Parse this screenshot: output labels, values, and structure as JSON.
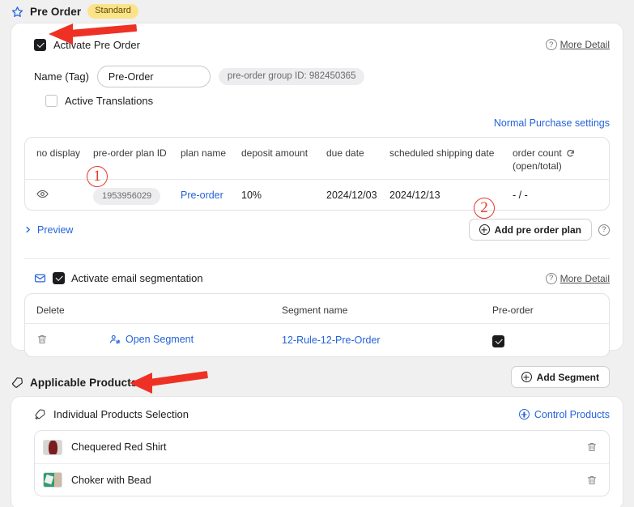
{
  "page": {
    "background": "#f0f0f0",
    "accent_blue": "#2563d9",
    "annotation_red": "#e8392a",
    "badge_yellow": "#fbe38a"
  },
  "pre_order_section": {
    "icon": "star-icon",
    "title": "Pre Order",
    "badge": "Standard",
    "activate": {
      "label": "Activate Pre Order",
      "checked": true
    },
    "more_detail": "More Detail",
    "name_tag": {
      "label": "Name (Tag)",
      "value": "Pre-Order",
      "placeholder": "Pre-Order"
    },
    "group_id_pill": "pre-order group ID: 982450365",
    "active_translations": {
      "label": "Active Translations",
      "checked": false
    },
    "normal_purchase_link": "Normal Purchase settings",
    "plan_table": {
      "headers": [
        "no display",
        "pre-order plan ID",
        "plan name",
        "deposit amount",
        "due date",
        "scheduled shipping date",
        "order count"
      ],
      "order_count_sub": "(open/total)",
      "order_count_refresh_icon": "refresh-icon",
      "rows": [
        {
          "no_display_icon": "eye-icon",
          "plan_id": "1953956029",
          "plan_name": "Pre-order",
          "deposit_amount": "10%",
          "due_date": "2024/12/03",
          "scheduled_shipping_date": "2024/12/13",
          "order_count": "- / -"
        }
      ]
    },
    "preview_link": "Preview",
    "add_plan_button": "Add pre order plan"
  },
  "email_segmentation": {
    "icon": "envelope-icon",
    "label": "Activate email segmentation",
    "checked": true,
    "more_detail": "More Detail",
    "table": {
      "headers": [
        "Delete",
        "",
        "Segment name",
        "Pre-order"
      ],
      "rows": [
        {
          "delete_icon": "trash-icon",
          "open_segment": "Open Segment",
          "open_segment_icon": "user-settings-icon",
          "segment_name": "12-Rule-12-Pre-Order",
          "pre_order_checked": true
        }
      ]
    },
    "add_segment_button": "Add Segment"
  },
  "applicable_products": {
    "icon": "tag-icon",
    "title": "Applicable Products",
    "selection_label": "Individual Products Selection",
    "selection_icon": "add-tag-icon",
    "control_products_link": "Control Products",
    "items": [
      {
        "name": "Chequered Red Shirt",
        "thumb_colors": [
          "#d8d5d2",
          "#7a1c20"
        ],
        "delete_icon": "trash-icon"
      },
      {
        "name": "Choker with Bead",
        "thumb_colors": [
          "#2f9e6e",
          "#cdbba6"
        ],
        "delete_icon": "trash-icon"
      }
    ]
  },
  "annotations": {
    "marker_1": "1",
    "marker_2": "2",
    "arrows": [
      "arrow-to-activate-checkbox",
      "arrow-to-applicable-products"
    ]
  }
}
